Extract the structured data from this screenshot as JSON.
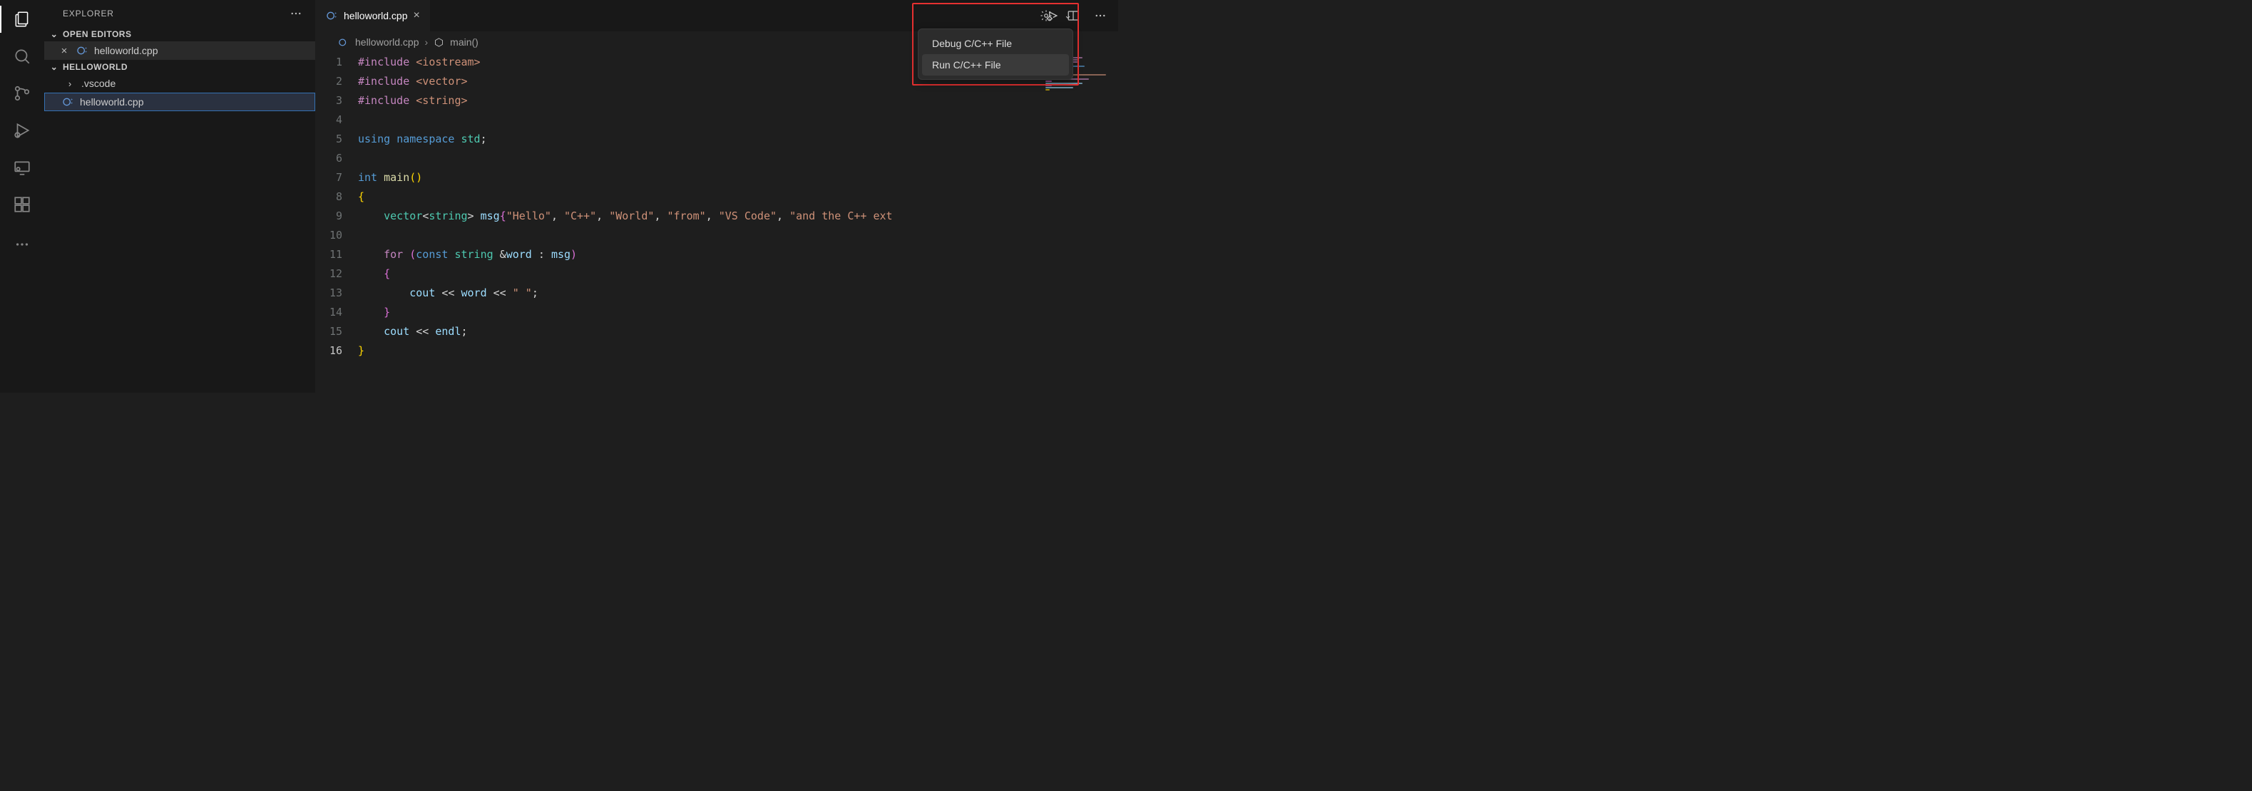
{
  "explorer": {
    "title": "EXPLORER",
    "sections": {
      "open_editors": {
        "label": "OPEN EDITORS",
        "files": [
          {
            "name": "helloworld.cpp"
          }
        ]
      },
      "workspace": {
        "label": "HELLOWORLD",
        "items": [
          {
            "kind": "folder",
            "name": ".vscode"
          },
          {
            "kind": "file",
            "name": "helloworld.cpp",
            "selected": true
          }
        ]
      }
    }
  },
  "tabs": {
    "active": {
      "name": "helloworld.cpp"
    }
  },
  "breadcrumb": {
    "file": "helloworld.cpp",
    "symbol": "main()"
  },
  "run_menu": {
    "items": [
      {
        "label": "Debug C/C++ File"
      },
      {
        "label": "Run C/C++ File",
        "hover": true
      }
    ]
  },
  "code": {
    "lines": [
      {
        "n": 1,
        "tokens": [
          {
            "t": "#include ",
            "c": "tk-macro"
          },
          {
            "t": "<iostream>",
            "c": "tk-inc"
          }
        ]
      },
      {
        "n": 2,
        "tokens": [
          {
            "t": "#include ",
            "c": "tk-macro"
          },
          {
            "t": "<vector>",
            "c": "tk-inc"
          }
        ]
      },
      {
        "n": 3,
        "tokens": [
          {
            "t": "#include ",
            "c": "tk-macro"
          },
          {
            "t": "<string>",
            "c": "tk-inc"
          }
        ]
      },
      {
        "n": 4,
        "tokens": []
      },
      {
        "n": 5,
        "tokens": [
          {
            "t": "using",
            "c": "tk-kw"
          },
          {
            "t": " "
          },
          {
            "t": "namespace",
            "c": "tk-kw"
          },
          {
            "t": " "
          },
          {
            "t": "std",
            "c": "tk-ns"
          },
          {
            "t": ";",
            "c": "tk-pun"
          }
        ]
      },
      {
        "n": 6,
        "tokens": []
      },
      {
        "n": 7,
        "tokens": [
          {
            "t": "int",
            "c": "tk-kw"
          },
          {
            "t": " "
          },
          {
            "t": "main",
            "c": "tk-func"
          },
          {
            "t": "()",
            "c": "tk-br-yellow"
          }
        ]
      },
      {
        "n": 8,
        "tokens": [
          {
            "t": "{",
            "c": "tk-br-yellow"
          }
        ]
      },
      {
        "n": 9,
        "tokens": [
          {
            "t": "    "
          },
          {
            "t": "vector",
            "c": "tk-type"
          },
          {
            "t": "<",
            "c": "tk-pun"
          },
          {
            "t": "string",
            "c": "tk-type"
          },
          {
            "t": "> ",
            "c": "tk-pun"
          },
          {
            "t": "msg",
            "c": "tk-var"
          },
          {
            "t": "{",
            "c": "tk-brace"
          },
          {
            "t": "\"Hello\"",
            "c": "tk-str"
          },
          {
            "t": ", "
          },
          {
            "t": "\"C++\"",
            "c": "tk-str"
          },
          {
            "t": ", "
          },
          {
            "t": "\"World\"",
            "c": "tk-str"
          },
          {
            "t": ", "
          },
          {
            "t": "\"from\"",
            "c": "tk-str"
          },
          {
            "t": ", "
          },
          {
            "t": "\"VS Code\"",
            "c": "tk-str"
          },
          {
            "t": ", "
          },
          {
            "t": "\"and the C++ ext",
            "c": "tk-str"
          }
        ]
      },
      {
        "n": 10,
        "tokens": []
      },
      {
        "n": 11,
        "tokens": [
          {
            "t": "    "
          },
          {
            "t": "for",
            "c": "tk-macro"
          },
          {
            "t": " "
          },
          {
            "t": "(",
            "c": "tk-brace"
          },
          {
            "t": "const",
            "c": "tk-kw"
          },
          {
            "t": " "
          },
          {
            "t": "string",
            "c": "tk-type"
          },
          {
            "t": " &"
          },
          {
            "t": "word",
            "c": "tk-var"
          },
          {
            "t": " : "
          },
          {
            "t": "msg",
            "c": "tk-var"
          },
          {
            "t": ")",
            "c": "tk-brace"
          }
        ]
      },
      {
        "n": 12,
        "tokens": [
          {
            "t": "    "
          },
          {
            "t": "{",
            "c": "tk-brace"
          }
        ]
      },
      {
        "n": 13,
        "tokens": [
          {
            "t": "        "
          },
          {
            "t": "cout",
            "c": "tk-var"
          },
          {
            "t": " << "
          },
          {
            "t": "word",
            "c": "tk-var"
          },
          {
            "t": " << "
          },
          {
            "t": "\" \"",
            "c": "tk-str"
          },
          {
            "t": ";"
          }
        ]
      },
      {
        "n": 14,
        "tokens": [
          {
            "t": "    "
          },
          {
            "t": "}",
            "c": "tk-brace"
          }
        ]
      },
      {
        "n": 15,
        "tokens": [
          {
            "t": "    "
          },
          {
            "t": "cout",
            "c": "tk-var"
          },
          {
            "t": " << "
          },
          {
            "t": "endl",
            "c": "tk-var"
          },
          {
            "t": ";"
          }
        ]
      },
      {
        "n": 16,
        "current": true,
        "tokens": [
          {
            "t": "}",
            "c": "tk-br-yellow"
          }
        ]
      }
    ]
  },
  "colors": {
    "highlight_border": "#e63030"
  }
}
